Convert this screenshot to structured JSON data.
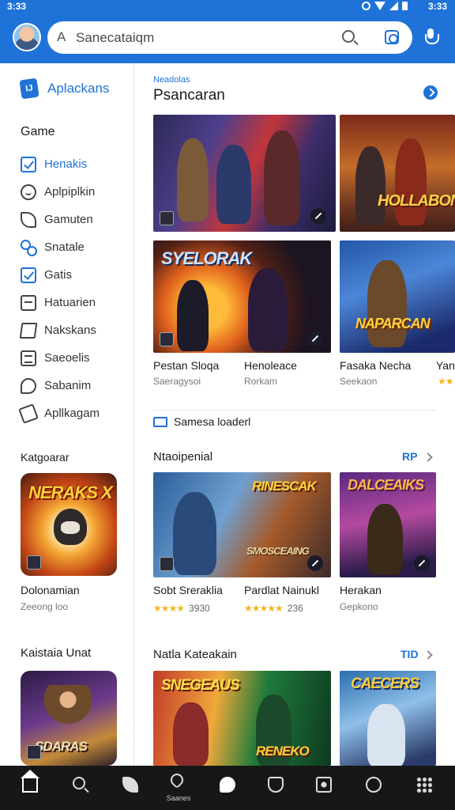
{
  "status": {
    "time_left": "3:33",
    "time_right": "3:33"
  },
  "search": {
    "leading_glyph": "A",
    "text": "Sanecataiqm"
  },
  "sidebar": {
    "brand": "Aplackans",
    "section": "Game",
    "items": [
      {
        "label": "Henakis",
        "icon": "checkbox-icon",
        "active": true
      },
      {
        "label": "Aplpiplkin",
        "icon": "smile-icon",
        "active": false
      },
      {
        "label": "Gamuten",
        "icon": "leaf-icon",
        "active": false
      },
      {
        "label": "Snatale",
        "icon": "link-icon",
        "active": false
      },
      {
        "label": "Gatis",
        "icon": "checkbox-icon",
        "active": true
      },
      {
        "label": "Hatuarien",
        "icon": "box-icon",
        "active": false
      },
      {
        "label": "Nakskans",
        "icon": "map-icon",
        "active": false
      },
      {
        "label": "Saeoelis",
        "icon": "list-icon",
        "active": false
      },
      {
        "label": "Sabanim",
        "icon": "chat-icon",
        "active": false
      },
      {
        "label": "Apllkagam",
        "icon": "pen-icon",
        "active": false
      }
    ],
    "category_heading": "Katgoarar",
    "card1_logo": "NERAKS X",
    "card1_title": "Dolonamian",
    "card1_sub": "Zeeong loo",
    "heading2": "Kaistaia Unat",
    "card2_logo": "SDARAS"
  },
  "main": {
    "kicker": "Neadolas",
    "title": "Psancaran",
    "hero2_logo": "HOLLABON",
    "tile_a_logo": "SYELORAK",
    "tile_b_logo": "NAPARCAN",
    "games_row1": [
      {
        "name": "Pestan Sloqa",
        "sub": "Saeragysoi"
      },
      {
        "name": "Henoleace",
        "sub": "Rorkam"
      },
      {
        "name": "Fasaka Necha",
        "sub": "Seekaon"
      },
      {
        "name": "Yan",
        "sub": ""
      }
    ],
    "notice": "Samesa loaderl",
    "section2": {
      "title": "Ntaoipenial",
      "more": "RP"
    },
    "tile_c_logo": "RINESCAK",
    "tile_c_logo2": "SMOSCEAING",
    "tile_d_logo": "DALCEAIKS",
    "games_row2": [
      {
        "name": "Sobt Sreraklia",
        "stars": "★★★★",
        "count": "3930"
      },
      {
        "name": "Pardlat Nainukl",
        "stars": "★★★★★",
        "count": "236"
      },
      {
        "name": "Herakan",
        "sub": "Gepkono"
      }
    ],
    "section3": {
      "title": "Natla Kateakain",
      "more": "TID"
    },
    "tile_e_logo": "SNEGEAUS",
    "tile_e_logo2": "RENEKO",
    "tile_f_logo": "CAECERS"
  },
  "bottom_nav": [
    {
      "icon": "home-icon",
      "label": ""
    },
    {
      "icon": "search-icon",
      "label": ""
    },
    {
      "icon": "leaf-icon",
      "label": ""
    },
    {
      "icon": "heart-icon",
      "label": "Saanes"
    },
    {
      "icon": "chat-bubble-icon",
      "label": ""
    },
    {
      "icon": "shield-icon",
      "label": ""
    },
    {
      "icon": "media-icon",
      "label": ""
    },
    {
      "icon": "explore-icon",
      "label": ""
    },
    {
      "icon": "more-dots-icon",
      "label": ""
    }
  ],
  "colors": {
    "accent": "#1f73d8",
    "nav_bg": "#171717",
    "star": "#f2b51a"
  }
}
